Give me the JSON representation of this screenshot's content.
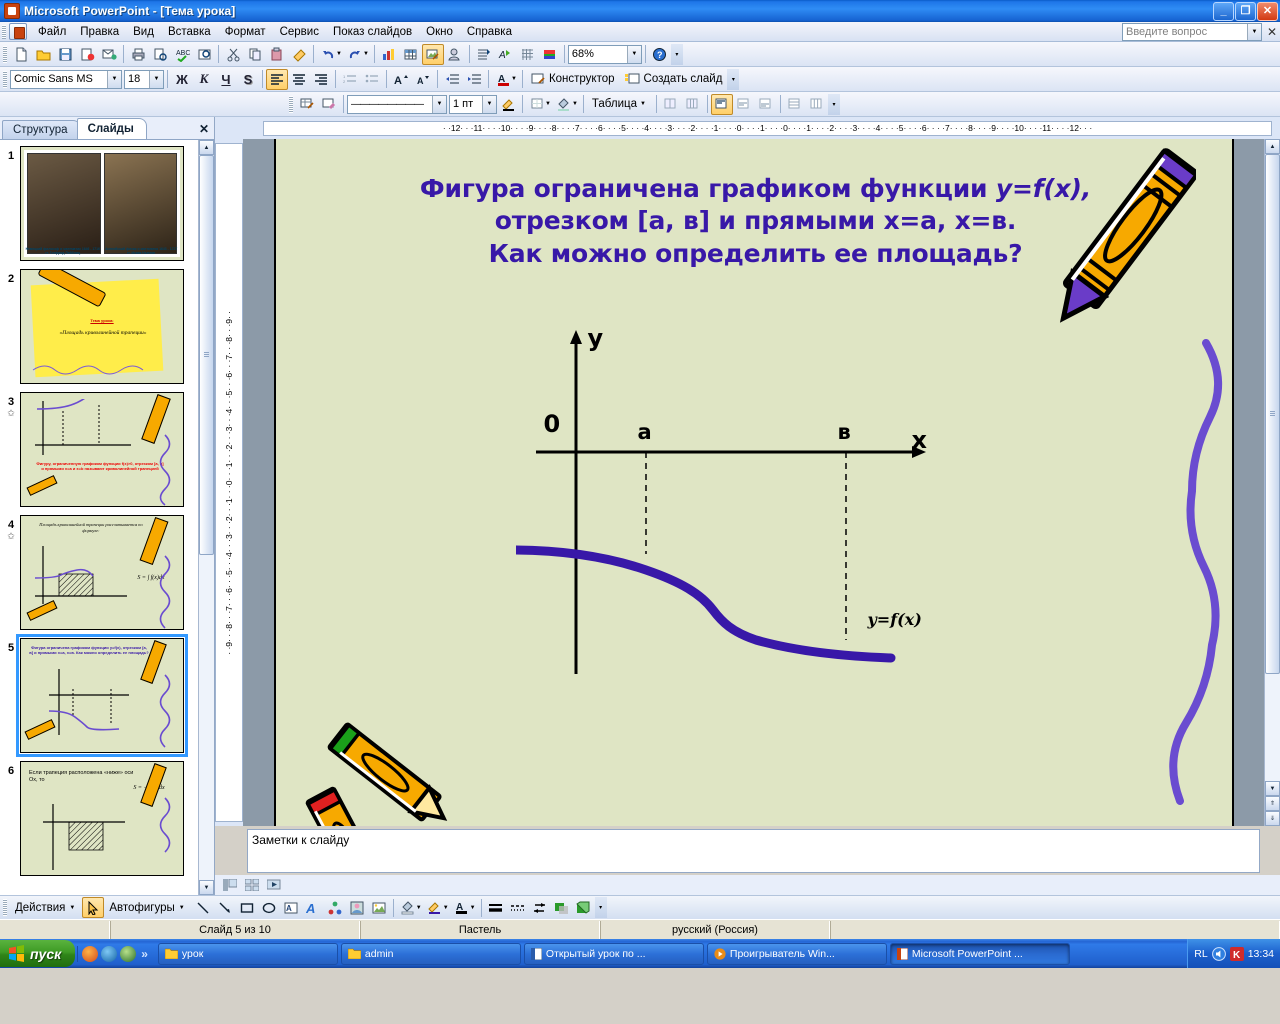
{
  "titlebar": {
    "title": "Microsoft PowerPoint - [Тема урока]",
    "icon": "powerpoint-icon",
    "minimize": "_",
    "restore": "❐",
    "close": "✕"
  },
  "menubar": {
    "items": [
      {
        "label": "Файл"
      },
      {
        "label": "Правка"
      },
      {
        "label": "Вид"
      },
      {
        "label": "Вставка"
      },
      {
        "label": "Формат"
      },
      {
        "label": "Сервис"
      },
      {
        "label": "Показ слайдов"
      },
      {
        "label": "Окно"
      },
      {
        "label": "Справка"
      }
    ],
    "ask_placeholder": "Введите вопрос",
    "close_label": "✕"
  },
  "standard_toolbar": {
    "zoom_value": "68%",
    "buttons": [
      "new-icon",
      "open-icon",
      "save-icon",
      "permission-icon",
      "email-icon",
      "print-icon",
      "print-preview-icon",
      "spelling-icon",
      "research-icon",
      "cut-icon",
      "copy-icon",
      "paste-icon",
      "format-painter-icon",
      "undo-icon",
      "redo-icon",
      "insert-chart-icon",
      "insert-table-icon",
      "insert-picture-icon",
      "insert-clipart-icon",
      "tables-borders-icon",
      "animation-icon",
      "grid-icon",
      "color-icon",
      "help-icon"
    ]
  },
  "formatting_toolbar": {
    "font_name": "Comic Sans MS",
    "font_size": "18",
    "bold": "Ж",
    "italic": "К",
    "underline": "Ч",
    "shadow": "S",
    "designer_label": "Конструктор",
    "new_slide_label": "Создать слайд"
  },
  "tables_toolbar": {
    "line_style": "————————",
    "line_weight": "1 пт",
    "table_label": "Таблица"
  },
  "left_pane": {
    "tabs": [
      {
        "label": "Структура",
        "active": false
      },
      {
        "label": "Слайды",
        "active": true
      }
    ],
    "close_label": "✕",
    "slides": [
      {
        "number": "1",
        "selected": false,
        "has_anim_star": false,
        "kind": "portraits",
        "caption_left": "Немецкий философ и математик 1646 - 1716 гг. Готфрид Лейбниц",
        "caption_right": "Английский физик и математик 1643 - 1727 гг. Исаак Ньютон"
      },
      {
        "number": "2",
        "selected": false,
        "has_anim_star": false,
        "kind": "topic",
        "label": "Тема урока:",
        "text": "«Площадь криволинейной трапеции»"
      },
      {
        "number": "3",
        "selected": false,
        "has_anim_star": true,
        "kind": "graph-up",
        "text": "Фигуру, ограниченную графиком функции f(x)>0, отрезком [a, b] и прямыми x=a и x=b называют криволинейной трапецией"
      },
      {
        "number": "4",
        "selected": false,
        "has_anim_star": true,
        "kind": "graph-hatched",
        "text": "Площадь криволинейной трапеции рассчитывается по формуле:",
        "formula": "S = ∫ f(x)dx"
      },
      {
        "number": "5",
        "selected": true,
        "has_anim_star": false,
        "kind": "graph-down",
        "text": "Фигура ограничена графиком функции y=f(x), отрезком [а, в] и прямыми x=а, x=в. Как можно определить ее площадь?"
      },
      {
        "number": "6",
        "selected": false,
        "has_anim_star": false,
        "kind": "graph-below",
        "text": "Если трапеция расположена «ниже» оси Ox, то",
        "formula": "S = −∫ f(x)dx"
      }
    ]
  },
  "rulers": {
    "horizontal": "·  ·12·  ·  ·11·  ·  ·  ·10·  ·  ·  ·9·  ·  ·  ·8·  ·  ·  ·7·  ·  ·  ·6·  ·  ·  ·5·  ·  ·  ·4·  ·  ·  ·3·  ·  ·  ·2·  ·  ·  ·1·  ·  ·  ·0·  ·  ·  ·1·  ·  ·  ·0·  ·  ·  ·1·  ·  ·  ·2·  ·  ·  ·3·  ·  ·  ·4·  ·  ·  ·5·  ·  ·  ·6·  ·  ·  ·7·  ·  ·  ·8·  ·  ·  ·9·  ·  ·  ·10·  ·  ·  ·11·  ·  ·  ·12·  ·  ·",
    "vertical": "·  ·9·  ·  ·8·  ·  ·7·  ·  ·6·  ·  ·5·  ·  ·4·  ·  ·3·  ·  ·2·  ·  ·1·  ·  ·0·  ·  ·1·  ·  ·2·  ·  ·3·  ·  ·4·  ·  ·5·  ·  ·6·  ·  ·7·  ·  ·8·  ·  ·9·  ·"
  },
  "slide": {
    "background_color": "#dfe5c4",
    "title_color": "#3818a8",
    "title_line1_a": "Фигура ограничена графиком функции ",
    "title_line1_b": "y=f(x),",
    "title_line2": "отрезком [а, в] и прямыми x=а, x=в.",
    "title_line3": "Как можно определить ее площадь?",
    "graph": {
      "y_axis_label": "y",
      "x_axis_label": "x",
      "origin_label": "0",
      "point_a_label": "а",
      "point_b_label": "в",
      "curve_label": "y=f(x)",
      "curve_color": "#3818a8"
    },
    "decorations": [
      {
        "name": "crayon-top-right",
        "body_color": "#f7a900",
        "tip_color": "#6a3cc8"
      },
      {
        "name": "crayons-bottom-left",
        "body_color": "#f7a900",
        "tip_colors": [
          "#1aa01a",
          "#e02020"
        ]
      },
      {
        "name": "squiggle-right",
        "color": "#6a4cd0"
      }
    ]
  },
  "notes": {
    "placeholder_text": "Заметки к слайду"
  },
  "draw_toolbar": {
    "actions_label": "Действия",
    "autoshapes_label": "Автофигуры",
    "buttons": [
      "select-arrow-icon",
      "line-icon",
      "arrow-icon",
      "rectangle-icon",
      "oval-icon",
      "textbox-icon",
      "wordart-icon",
      "diagram-icon",
      "clipart-icon",
      "picture-icon",
      "fill-color-icon",
      "line-color-icon",
      "font-color-icon",
      "line-style-icon",
      "dash-style-icon",
      "arrow-style-icon",
      "shadow-icon",
      "3d-icon"
    ]
  },
  "statusbar": {
    "slide_counter": "Слайд 5 из 10",
    "design_name": "Пастель",
    "language": "русский (Россия)"
  },
  "taskbar": {
    "start_label": "пуск",
    "quicklaunch": [
      "browser-icon",
      "ie-icon",
      "media-icon"
    ],
    "overflow": "»",
    "tasks": [
      {
        "label": "урок",
        "icon": "folder-icon",
        "active": false
      },
      {
        "label": "admin",
        "icon": "folder-icon",
        "active": false
      },
      {
        "label": "Открытый урок по ...",
        "icon": "word-icon",
        "active": false
      },
      {
        "label": "Проигрыватель Win...",
        "icon": "media-icon",
        "active": false
      },
      {
        "label": "Microsoft PowerPoint ...",
        "icon": "powerpoint-icon",
        "active": true
      }
    ],
    "tray": {
      "language": "RL",
      "volume_icon": "volume-icon",
      "antivirus_icon": "kaspersky-icon",
      "clock": "13:34"
    }
  }
}
